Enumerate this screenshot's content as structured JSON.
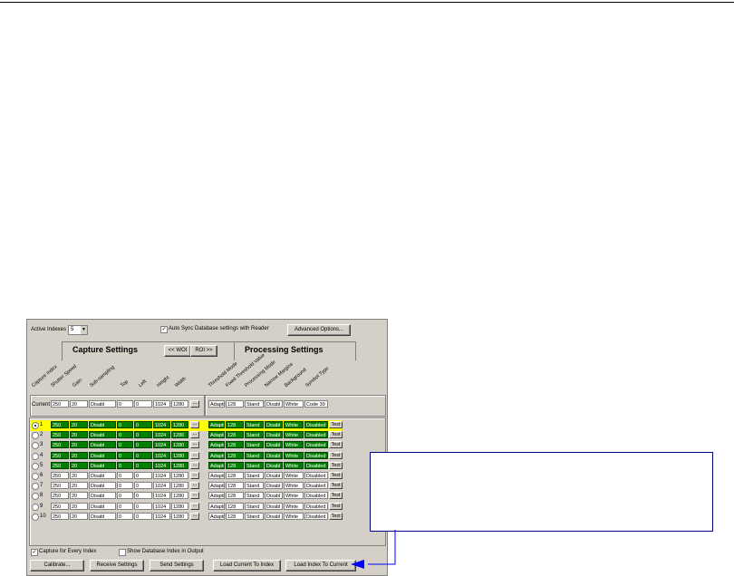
{
  "toolbar": {
    "active_indexes_label": "Active Indexes",
    "active_indexes_value": "5",
    "auto_sync_label": "Auto Sync Database settings with Reader",
    "auto_sync_checked": true,
    "advanced_options_label": "Advanced Options..."
  },
  "tabs": {
    "capture_title": "Capture Settings",
    "processing_title": "Processing Settings",
    "wo_label": "<< WOI",
    "roi_label": "ROI >>"
  },
  "capture_columns": [
    "Capture Index",
    "Shutter Speed",
    "Gain",
    "Sub-sampling",
    "Top",
    "Left",
    "Height",
    "Width"
  ],
  "processing_columns": [
    "Threshold Mode",
    "Fixed Threshold Value",
    "Processing Mode",
    "Narrow Margins",
    "Background",
    "Symbol Type"
  ],
  "current": {
    "label": "Current",
    "capture": [
      "250",
      "20",
      "Disabl",
      "0",
      "0",
      "1024",
      "1280"
    ],
    "processing": [
      "Adapti",
      "128",
      "Stand",
      "Disabl",
      "White",
      "Code 39"
    ]
  },
  "rows": [
    {
      "index": "1",
      "capture": [
        "250",
        "20",
        "Disabl",
        "0",
        "0",
        "1024",
        "1280"
      ],
      "processing": [
        "Adapti",
        "128",
        "Stand",
        "Disabl",
        "White",
        "Disabled"
      ],
      "active": true,
      "selected": true
    },
    {
      "index": "2",
      "capture": [
        "250",
        "20",
        "Disabl",
        "0",
        "0",
        "1024",
        "1280"
      ],
      "processing": [
        "Adapti",
        "128",
        "Stand",
        "Disabl",
        "White",
        "Disabled"
      ],
      "active": true,
      "selected": false
    },
    {
      "index": "3",
      "capture": [
        "250",
        "20",
        "Disabl",
        "0",
        "0",
        "1024",
        "1280"
      ],
      "processing": [
        "Adapti",
        "128",
        "Stand",
        "Disabl",
        "White",
        "Disabled"
      ],
      "active": true,
      "selected": false
    },
    {
      "index": "4",
      "capture": [
        "250",
        "20",
        "Disabl",
        "0",
        "0",
        "1024",
        "1280"
      ],
      "processing": [
        "Adapti",
        "128",
        "Stand",
        "Disabl",
        "White",
        "Disabled"
      ],
      "active": true,
      "selected": false
    },
    {
      "index": "5",
      "capture": [
        "250",
        "20",
        "Disabl",
        "0",
        "0",
        "1024",
        "1280"
      ],
      "processing": [
        "Adapti",
        "128",
        "Stand",
        "Disabl",
        "White",
        "Disabled"
      ],
      "active": true,
      "selected": false
    },
    {
      "index": "6",
      "capture": [
        "250",
        "20",
        "Disabl",
        "0",
        "0",
        "1024",
        "1280"
      ],
      "processing": [
        "Adapti",
        "128",
        "Stand",
        "Disabl",
        "White",
        "Disabled"
      ],
      "active": false,
      "selected": false
    },
    {
      "index": "7",
      "capture": [
        "250",
        "20",
        "Disabl",
        "0",
        "0",
        "1024",
        "1280"
      ],
      "processing": [
        "Adapti",
        "128",
        "Stand",
        "Disabl",
        "White",
        "Disabled"
      ],
      "active": false,
      "selected": false
    },
    {
      "index": "8",
      "capture": [
        "250",
        "20",
        "Disabl",
        "0",
        "0",
        "1024",
        "1280"
      ],
      "processing": [
        "Adapti",
        "128",
        "Stand",
        "Disabl",
        "White",
        "Disabled"
      ],
      "active": false,
      "selected": false
    },
    {
      "index": "9",
      "capture": [
        "250",
        "20",
        "Disabl",
        "0",
        "0",
        "1024",
        "1280"
      ],
      "processing": [
        "Adapti",
        "128",
        "Stand",
        "Disabl",
        "White",
        "Disabled"
      ],
      "active": false,
      "selected": false
    },
    {
      "index": "10",
      "capture": [
        "250",
        "20",
        "Disabl",
        "0",
        "0",
        "1024",
        "1280"
      ],
      "processing": [
        "Adapti",
        "128",
        "Stand",
        "Disabl",
        "White",
        "Disabled"
      ],
      "active": false,
      "selected": false
    }
  ],
  "test_label": "Test",
  "options": {
    "capture_every_label": "Capture for Every Index",
    "capture_every_checked": true,
    "show_db_index_label": "Show Database Index in Output",
    "show_db_index_checked": false
  },
  "buttons": {
    "calibrate": "Calibrate...",
    "receive": "Receive Settings",
    "send": "Send Settings",
    "load_current_to_index": "Load Current To Index",
    "load_index_to_current": "Load Index To Current"
  },
  "colors": {
    "active_cell": "#008000",
    "selected_row": "#ffff00",
    "callout_border": "#000080",
    "arrow": "#0000ff"
  }
}
